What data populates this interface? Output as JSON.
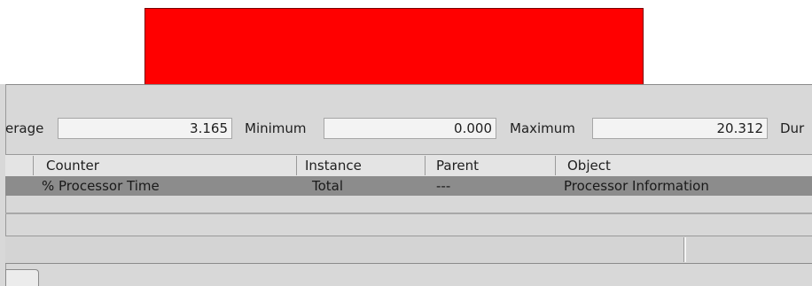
{
  "stats": {
    "average_label": "erage",
    "average_value": "3.165",
    "minimum_label": "Minimum",
    "minimum_value": "0.000",
    "maximum_label": "Maximum",
    "maximum_value": "20.312",
    "duration_label": "Dur"
  },
  "counter_list": {
    "columns": [
      "Counter",
      "Instance",
      "Parent",
      "Object"
    ],
    "rows": [
      {
        "counter": "% Processor Time",
        "instance": "Total",
        "parent": "---",
        "object": "Processor Information"
      }
    ]
  },
  "colors": {
    "graph_bar": "#ff0000",
    "selected_row": "#8c8c8c",
    "panel": "#d8d8d8"
  }
}
